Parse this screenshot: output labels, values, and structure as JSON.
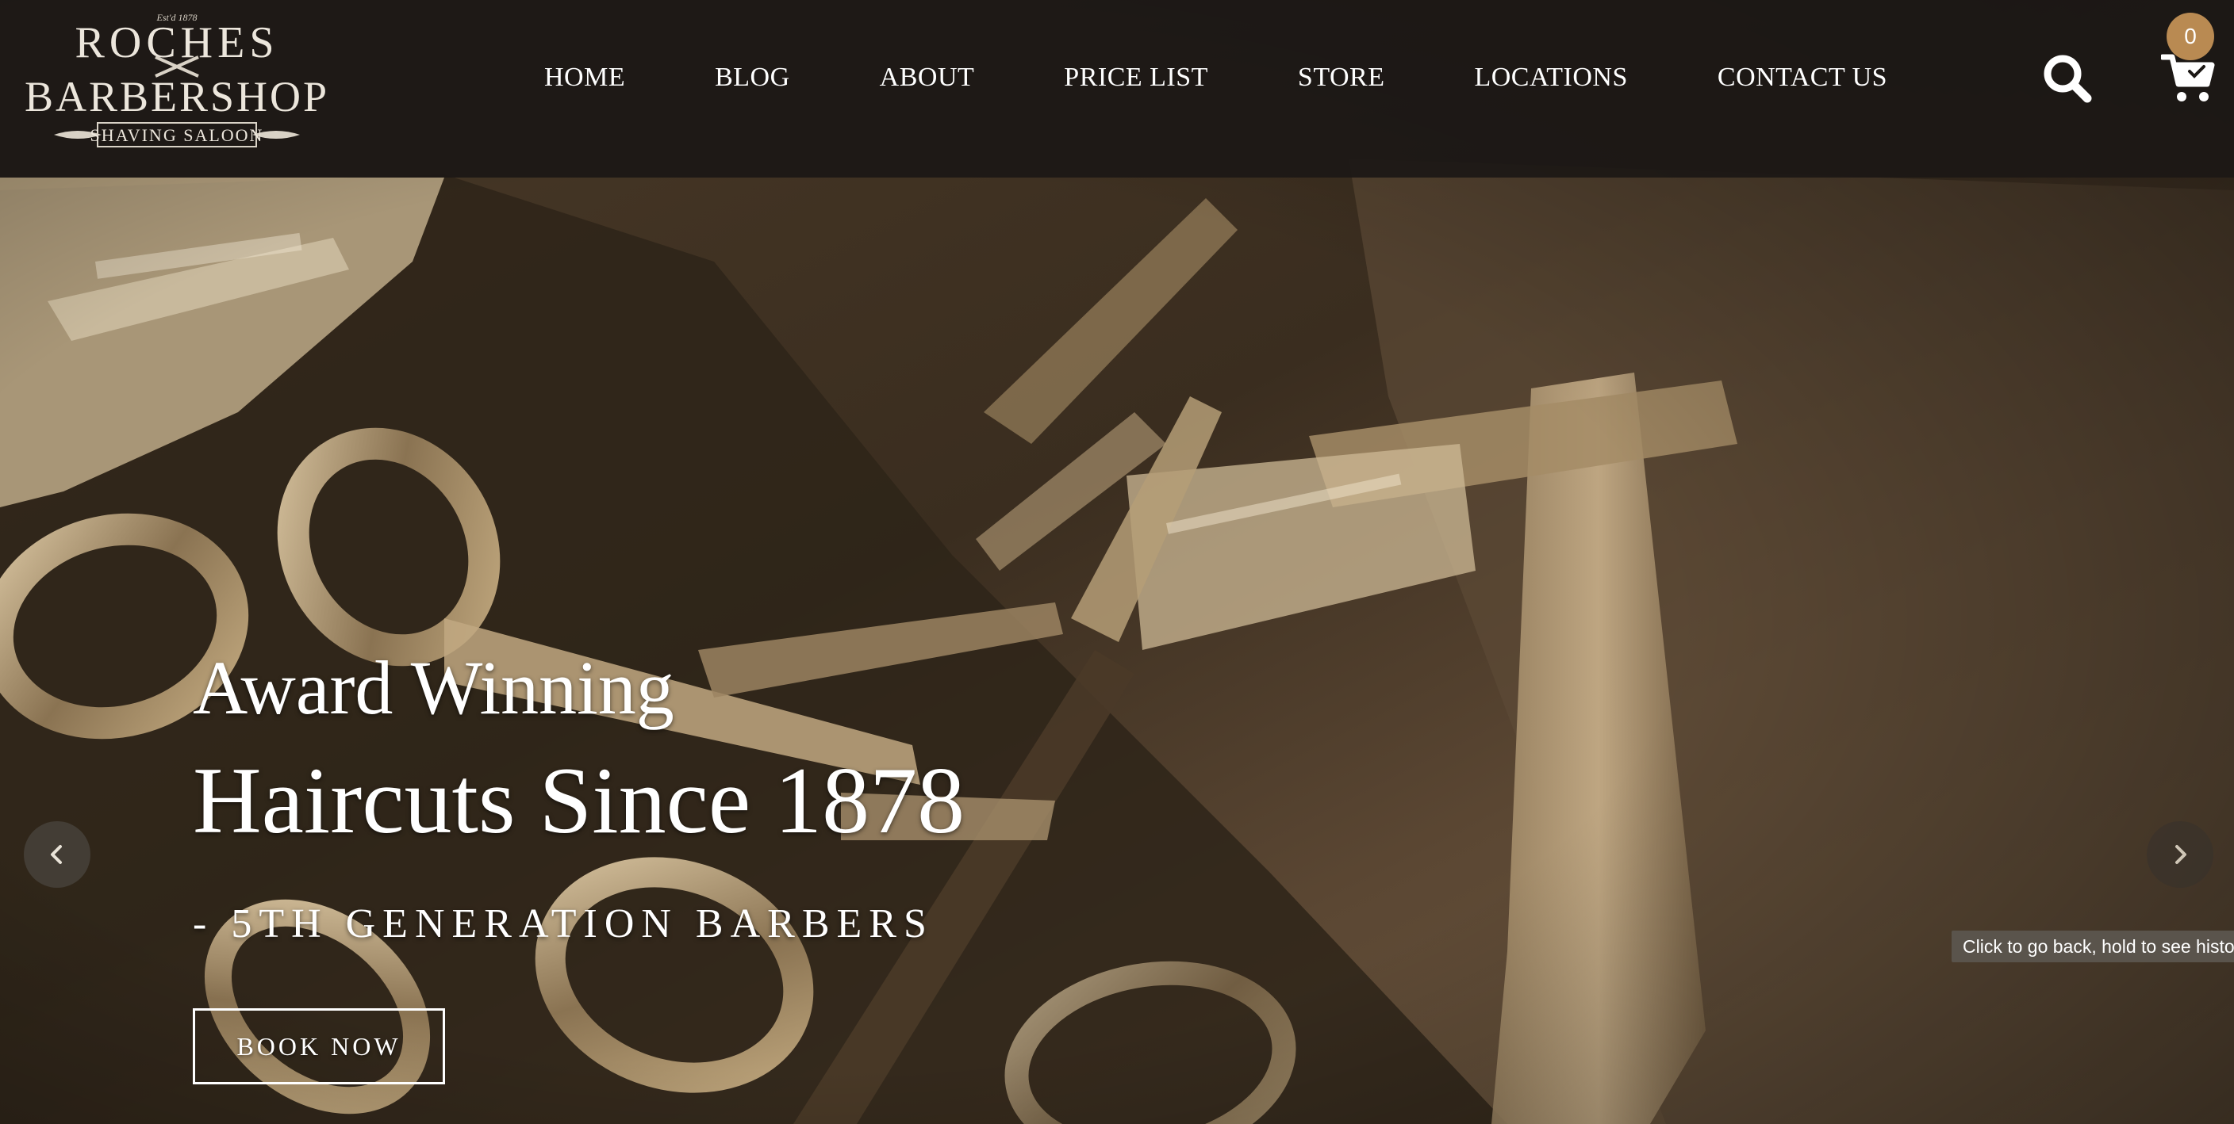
{
  "brand": {
    "estd": "Est'd 1878",
    "name_line_1": "ROCHES",
    "name_line_2": "BARBERSHOP",
    "tagline": "SHAVING SALOON"
  },
  "nav": {
    "items": [
      {
        "label": "HOME"
      },
      {
        "label": "BLOG"
      },
      {
        "label": "ABOUT"
      },
      {
        "label": "PRICE LIST"
      },
      {
        "label": "STORE"
      },
      {
        "label": "LOCATIONS"
      },
      {
        "label": "CONTACT US"
      }
    ]
  },
  "icons": {
    "search": "search-icon",
    "cart": "cart-icon",
    "prev": "chevron-left-icon",
    "next": "chevron-right-icon"
  },
  "cart": {
    "count": "0"
  },
  "hero": {
    "line_1": "Award Winning",
    "line_2": "Haircuts Since 1878",
    "subtitle": "- 5TH GENERATION BARBERS",
    "cta_label": "BOOK NOW"
  },
  "tooltip": {
    "text": "Click to go back, hold to see history"
  },
  "colors": {
    "header_bg": "#1c1815",
    "accent": "#b98a52",
    "text": "#ffffff",
    "sepia_dark": "#2a2118",
    "sepia_light": "#c9b08a"
  }
}
